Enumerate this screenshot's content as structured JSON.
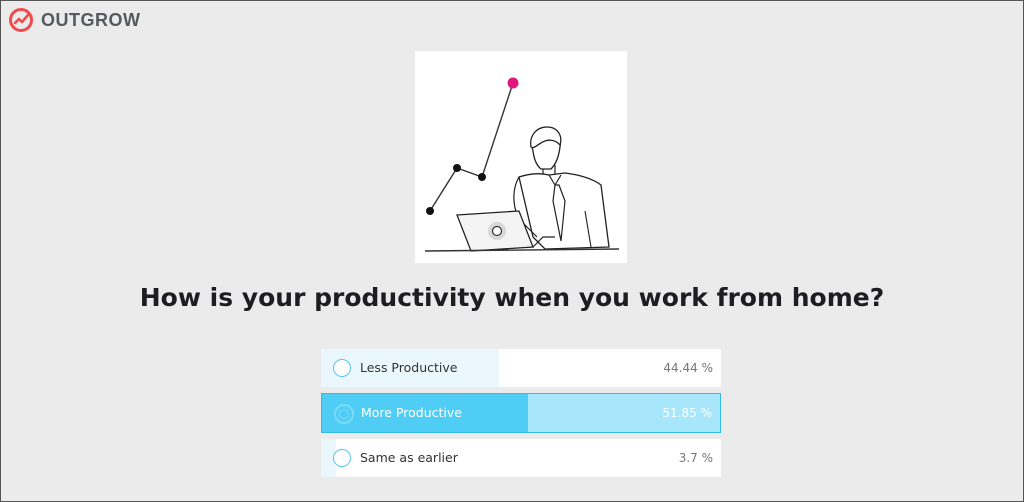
{
  "brand": {
    "name": "OUTGROW",
    "accent": "#ef4d4d"
  },
  "question": {
    "title": "How is your productivity when you work from home?"
  },
  "poll": {
    "options": [
      {
        "label": "Less Productive",
        "percent_text": "44.44 %",
        "share": 0.4444,
        "selected": false
      },
      {
        "label": "More Productive",
        "percent_text": "51.85 %",
        "share": 0.5185,
        "selected": true
      },
      {
        "label": "Same as earlier",
        "percent_text": "3.7 %",
        "share": 0.037,
        "selected": false
      }
    ],
    "colors": {
      "fill": "#eaf7fd",
      "selected_fill": "#4fcdf5",
      "selected_bg": "#a7e6fb",
      "radio": "#58c6ee"
    }
  },
  "illustration": {
    "icon": "man-at-laptop-growth-chart",
    "highlight_color": "#e0157e"
  }
}
